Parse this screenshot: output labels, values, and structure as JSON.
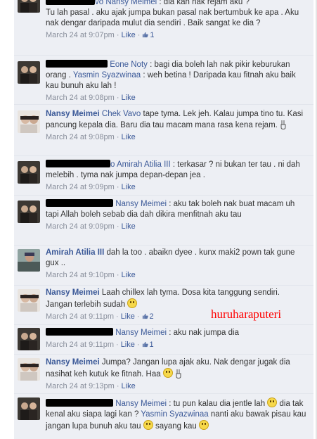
{
  "comments": [
    {
      "author": "Nansy Meimei",
      "author_tail": "vo",
      "text": ": dia kan nak rejam aku ?",
      "text2": "Tu lah pasal . aku ajak jumpa bukan pasal nak bertumbuk ke apa . Aku nak dengar daripada mulut dia sendiri . Baik sangat ke dia ?",
      "timestamp": "March 24 at 9:07pm",
      "like": "Like",
      "likes": "1"
    },
    {
      "author_tail": "Eone Noty",
      "text": ": bagi dia boleh lah nak pikir keburukan orang .",
      "mention": "Yasmin Syazwinaa",
      "text2": ": weh betina ! Daripada kau fitnah aku baik kau bunuh aku lah !",
      "timestamp": "March 24 at 9:08pm",
      "like": "Like"
    },
    {
      "author": "Nansy Meimei",
      "mention": "Chek Vavo",
      "text": "tape tyma. Lek jeh. Kalau jumpa tino tu. Kasi pancung kepala dia. Baru dia tau macam mana rasa kena rejam.",
      "timestamp": "March 24 at 9:08pm",
      "like": "Like"
    },
    {
      "author_tail": "o",
      "mention": "Amirah Atilia III",
      "text": ": terkasar ? ni bukan ter tau . ni dah melebih . tyma nak jumpa depan-depan jea .",
      "timestamp": "March 24 at 9:09pm",
      "like": "Like"
    },
    {
      "author_tail": "Nansy Meimei",
      "text": ": aku tak boleh nak buat macam uh tapi Allah boleh sebab dia dah dikira menfitnah aku tau",
      "timestamp": "March 24 at 9:09pm",
      "like": "Like"
    },
    {
      "author": "Amirah Atilia III",
      "text": "dah la too . abaikn dyee . kunx maki2 pown tak gune gux ..",
      "timestamp": "March 24 at 9:10pm",
      "like": "Like"
    },
    {
      "author": "Nansy Meimei",
      "text": "Laah chillex lah tyma. Dosa kita tanggung sendiri. Jangan terlebih sudah",
      "timestamp": "March 24 at 9:11pm",
      "like": "Like",
      "likes": "2"
    },
    {
      "author_tail": "Nansy Meimei",
      "text": ": aku nak jumpa dia",
      "timestamp": "March 24 at 9:11pm",
      "like": "Like",
      "likes": "1"
    },
    {
      "author": "Nansy Meimei",
      "text": "Jumpa? Jangan lupa ajak aku. Nak dengar jugak dia nasihat keh kutuk ke fitnah. Haa",
      "timestamp": "March 24 at 9:13pm",
      "like": "Like"
    },
    {
      "author_tail": "Nansy Meimei",
      "text": ": tu pun kalau dia jentle lah",
      "text2": "dia tak kenal aku siapa lagi kan ?",
      "mention": "Yasmin Syazwinaa",
      "text3": "nanti aku bawak pisau kau jangan lupa bunuh aku tau",
      "text4": "sayang kau"
    }
  ],
  "watermark": "huruharaputeri",
  "colors": {
    "link": "#3b5998",
    "comment_bg": "#edeff4",
    "meta": "#898f9c",
    "watermark": "#ff0000"
  },
  "icons": {
    "like": "thumbs-up-icon",
    "smile": "smile-emoji-icon",
    "peace": "peace-hand-icon"
  }
}
